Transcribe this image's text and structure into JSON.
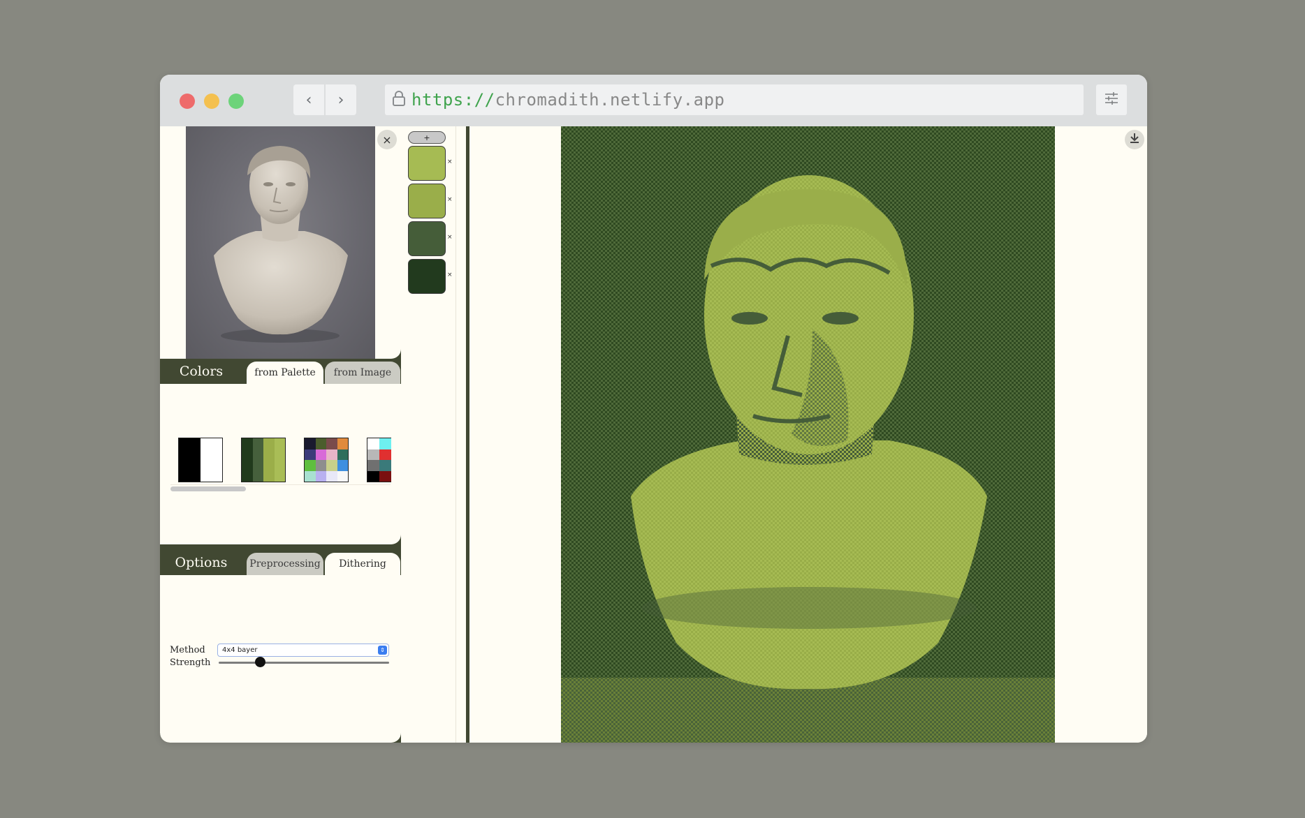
{
  "browser": {
    "url_scheme": "https://",
    "url_host": "chromadith.netlify.app",
    "back_glyph": "‹",
    "forward_glyph": "›"
  },
  "upload": {
    "close_label": "×"
  },
  "colors_section": {
    "title": "Colors",
    "tabs": [
      {
        "label": "from Palette",
        "active": true
      },
      {
        "label": "from Image",
        "active": false
      }
    ],
    "palettes": [
      {
        "name": "black-white",
        "colors": [
          "#000000",
          "#ffffff"
        ]
      },
      {
        "name": "green-4",
        "colors": [
          "#213a1c",
          "#46603c",
          "#9bae49",
          "#a9bd56"
        ]
      },
      {
        "name": "multicolor-16",
        "colors": [
          "#1a1a2e",
          "#4b5d2c",
          "#7a4b4b",
          "#e08a3c",
          "#3b3b7a",
          "#d86ad8",
          "#e8b4c8",
          "#2f6e5c",
          "#5fbf3f",
          "#8e8e8e",
          "#c8d08a",
          "#3f8fe0",
          "#a8e0d0",
          "#b8b0f0",
          "#e8e8f8",
          "#f8f8f8"
        ]
      },
      {
        "name": "multicolor-partial",
        "colors": [
          "#ffffff",
          "#6ef0f0",
          "#b8b8b8",
          "#e03030",
          "#707070",
          "#3a7a7a",
          "#000000",
          "#7a1010"
        ]
      }
    ]
  },
  "options_section": {
    "title": "Options",
    "tabs": [
      {
        "label": "Preprocessing",
        "active": false
      },
      {
        "label": "Dithering",
        "active": true
      }
    ],
    "method_label": "Method",
    "method_value": "4x4 bayer",
    "strength_label": "Strength",
    "strength_value": 0.24
  },
  "palette_editor": {
    "add_label": "+",
    "remove_label": "×",
    "swatches": [
      "#a6bb53",
      "#9aae4a",
      "#455d39",
      "#223a1e"
    ]
  },
  "colors": {
    "dark_bar": "#414832",
    "panel_bg": "#fffdf4",
    "dither_dark": "#2f4a21",
    "dither_light": "#a6bb53"
  }
}
